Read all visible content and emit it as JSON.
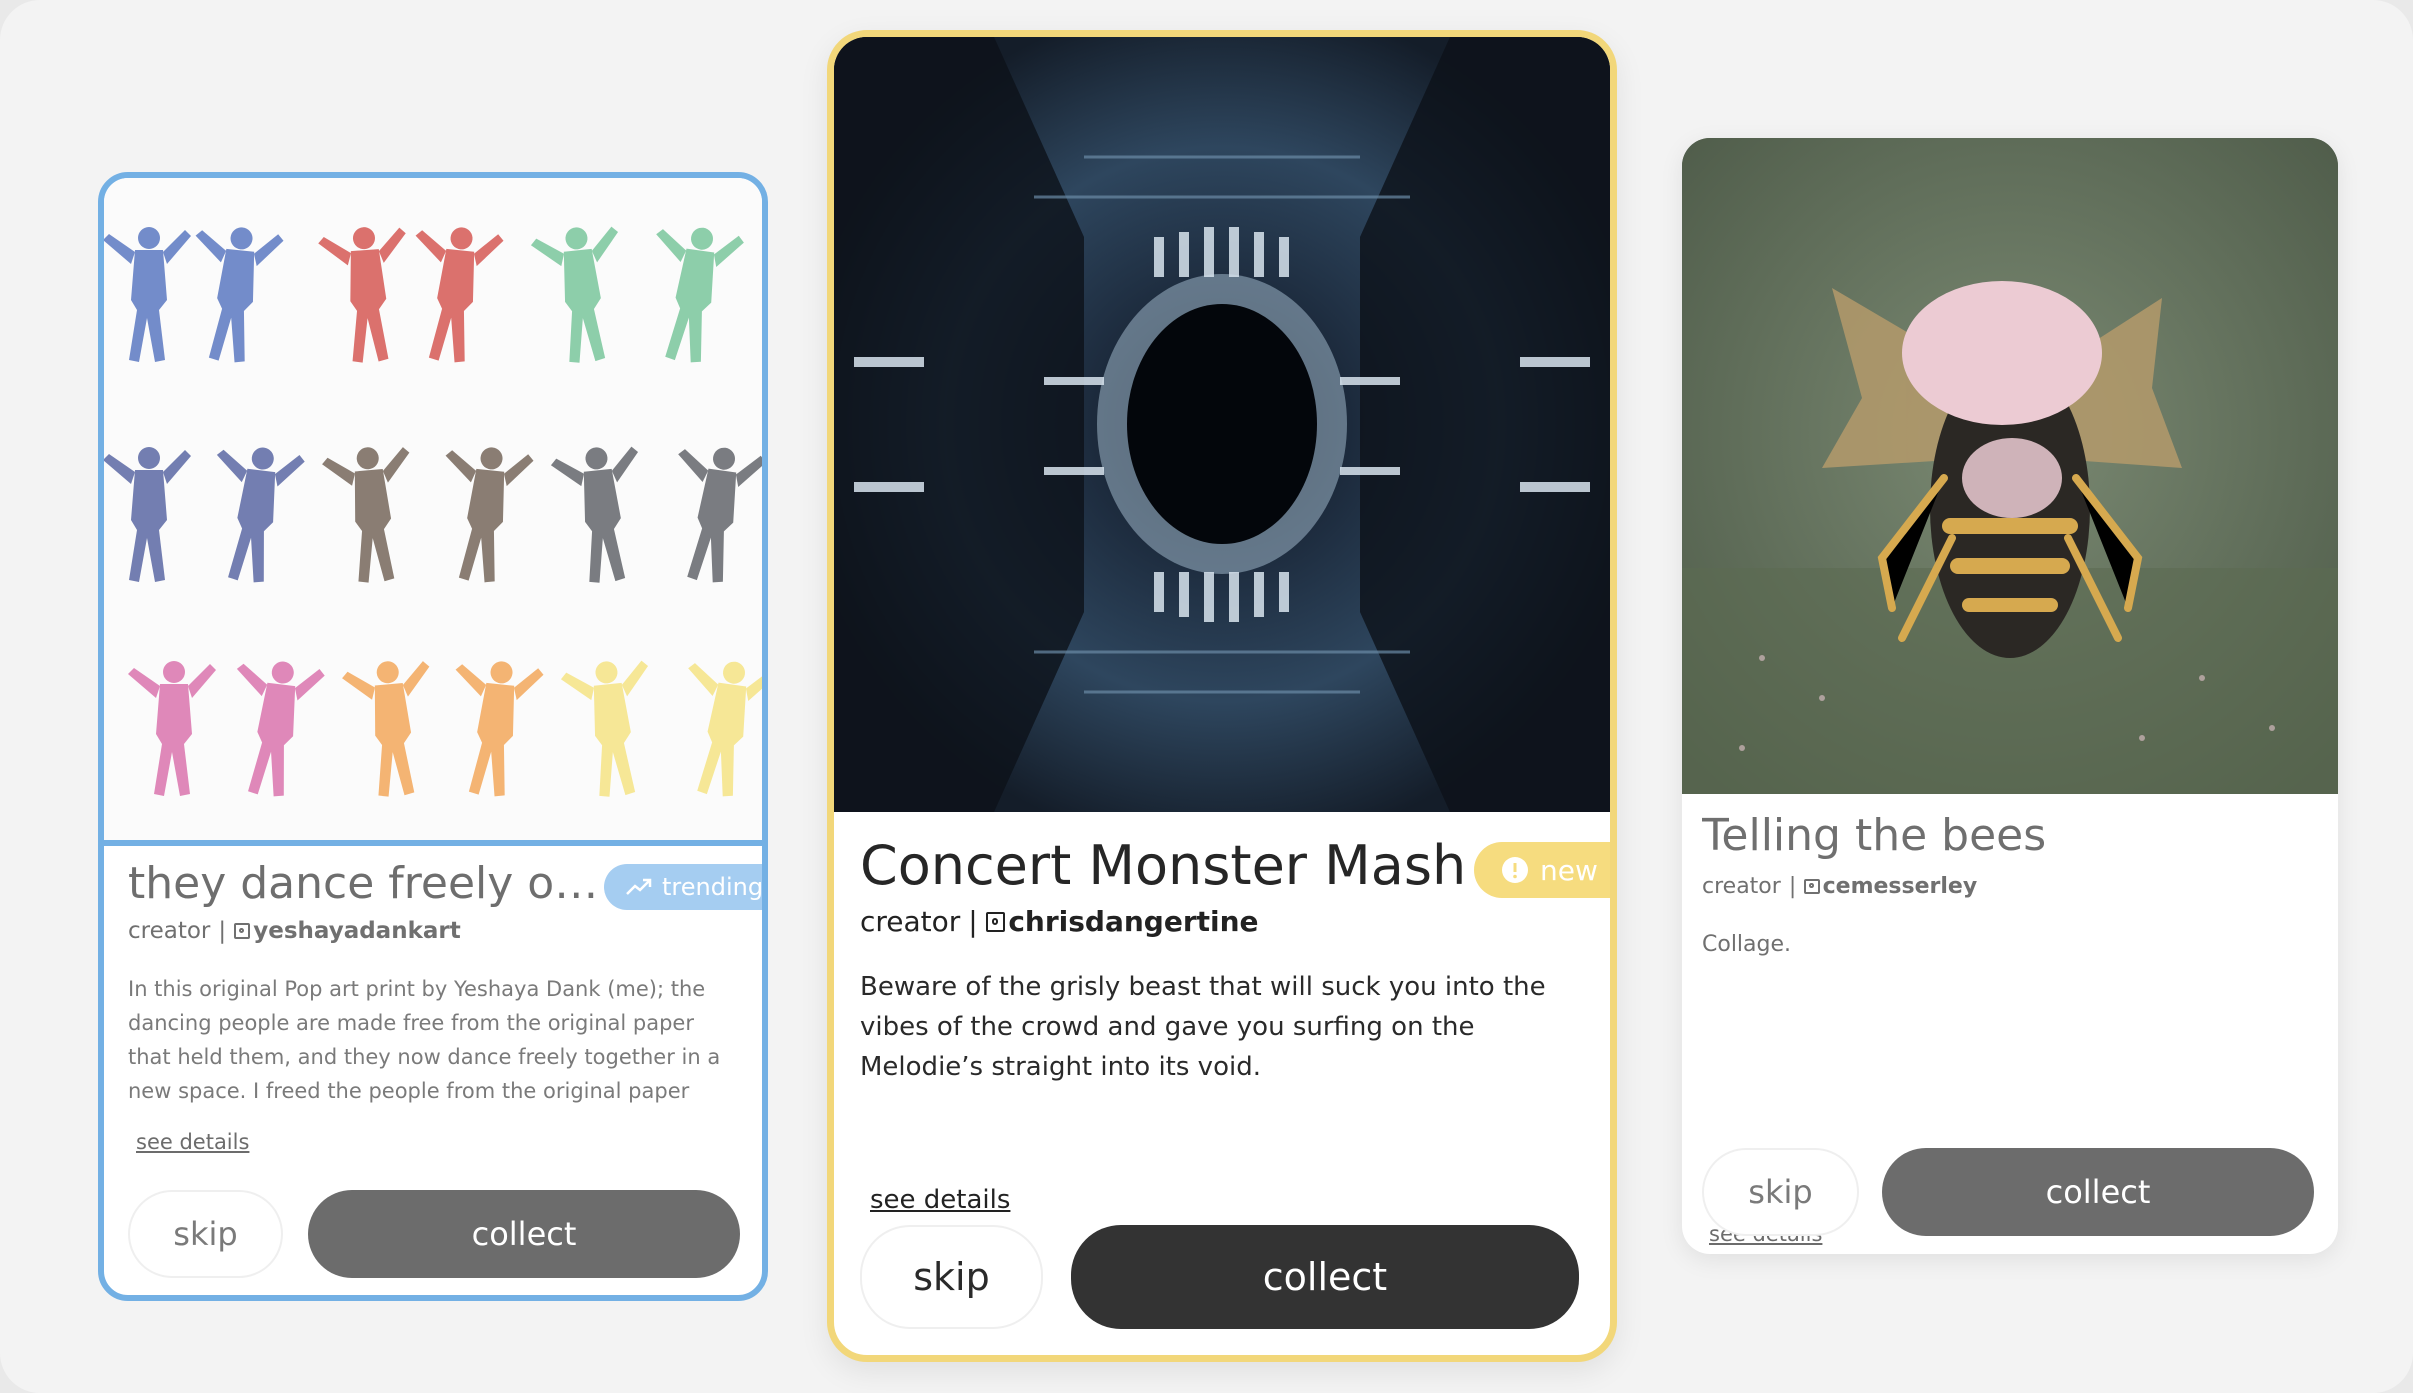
{
  "colors": {
    "trending_accent": "#73b0e4",
    "new_accent": "#f2d77a",
    "collect_primary": "#333333",
    "collect_muted": "#6c6c6c"
  },
  "cards": [
    {
      "title": "they dance freely off ...",
      "badge": {
        "label": "trending",
        "icon": "trending-up-icon"
      },
      "creator_label": "creator",
      "creator_sep": "|",
      "handle": "yeshayadankart",
      "description": "In this original Pop art print by Yeshaya Dank (me); the dancing people are made free from the original paper that held them, and they now dance freely together in a new space. I freed the people from the original paper that...",
      "details_label": "see details",
      "skip_label": "skip",
      "collect_label": "collect"
    },
    {
      "title": "Concert Monster Mash",
      "badge": {
        "label": "new",
        "icon": "new-seal-icon"
      },
      "creator_label": "creator",
      "creator_sep": "|",
      "handle": "chrisdangertine",
      "description": "Beware of the grisly beast that will suck you into the vibes of the crowd and gave you surfing on the Melodie’s straight into its void.",
      "details_label": "see details",
      "skip_label": "skip",
      "collect_label": "collect"
    },
    {
      "title": "Telling the bees",
      "creator_label": "creator",
      "creator_sep": "|",
      "handle": "cemesserley",
      "description": "Collage.",
      "details_label": "see details",
      "skip_label": "skip",
      "collect_label": "collect"
    }
  ]
}
